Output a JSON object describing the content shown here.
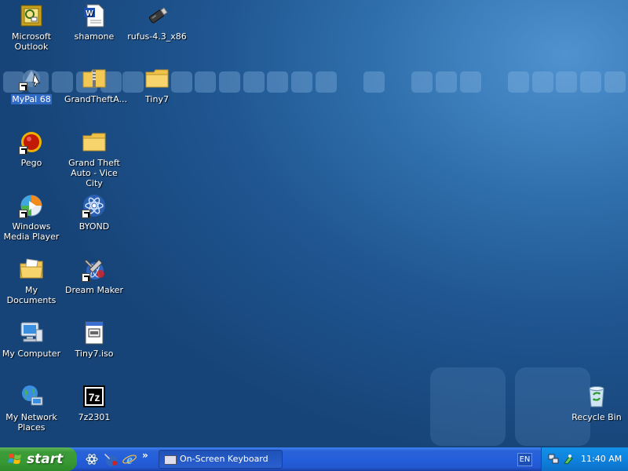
{
  "desktop": {
    "icons": {
      "outlook": "Microsoft Outlook",
      "shamone": "shamone",
      "rufus": "rufus-4.3_x86",
      "mypal": "MyPal 68",
      "gta_folder": "GrandTheftA...",
      "tiny7": "Tiny7",
      "pego": "Pego",
      "gta_vc": "Grand Theft Auto - Vice City",
      "wmp": "Windows Media Player",
      "byond": "BYOND",
      "my_documents": "My Documents",
      "dream_maker": "Dream Maker",
      "my_computer": "My Computer",
      "tiny7_iso": "Tiny7.iso",
      "my_network": "My Network Places",
      "sevenzip": "7z2301",
      "recycle_bin": "Recycle Bin"
    },
    "selected_icon": "MyPal 68"
  },
  "taskbar": {
    "start_label": "start",
    "quick_launch_more": "»",
    "tasks": [
      "On-Screen Keyboard"
    ],
    "language": "EN",
    "clock": "11:40 AM"
  },
  "colors": {
    "desktop_bg": "#2f6fac",
    "taskbar": "#245edb",
    "start_button": "#3c9b38",
    "tray": "#0f83df",
    "selection": "#316ac5"
  }
}
